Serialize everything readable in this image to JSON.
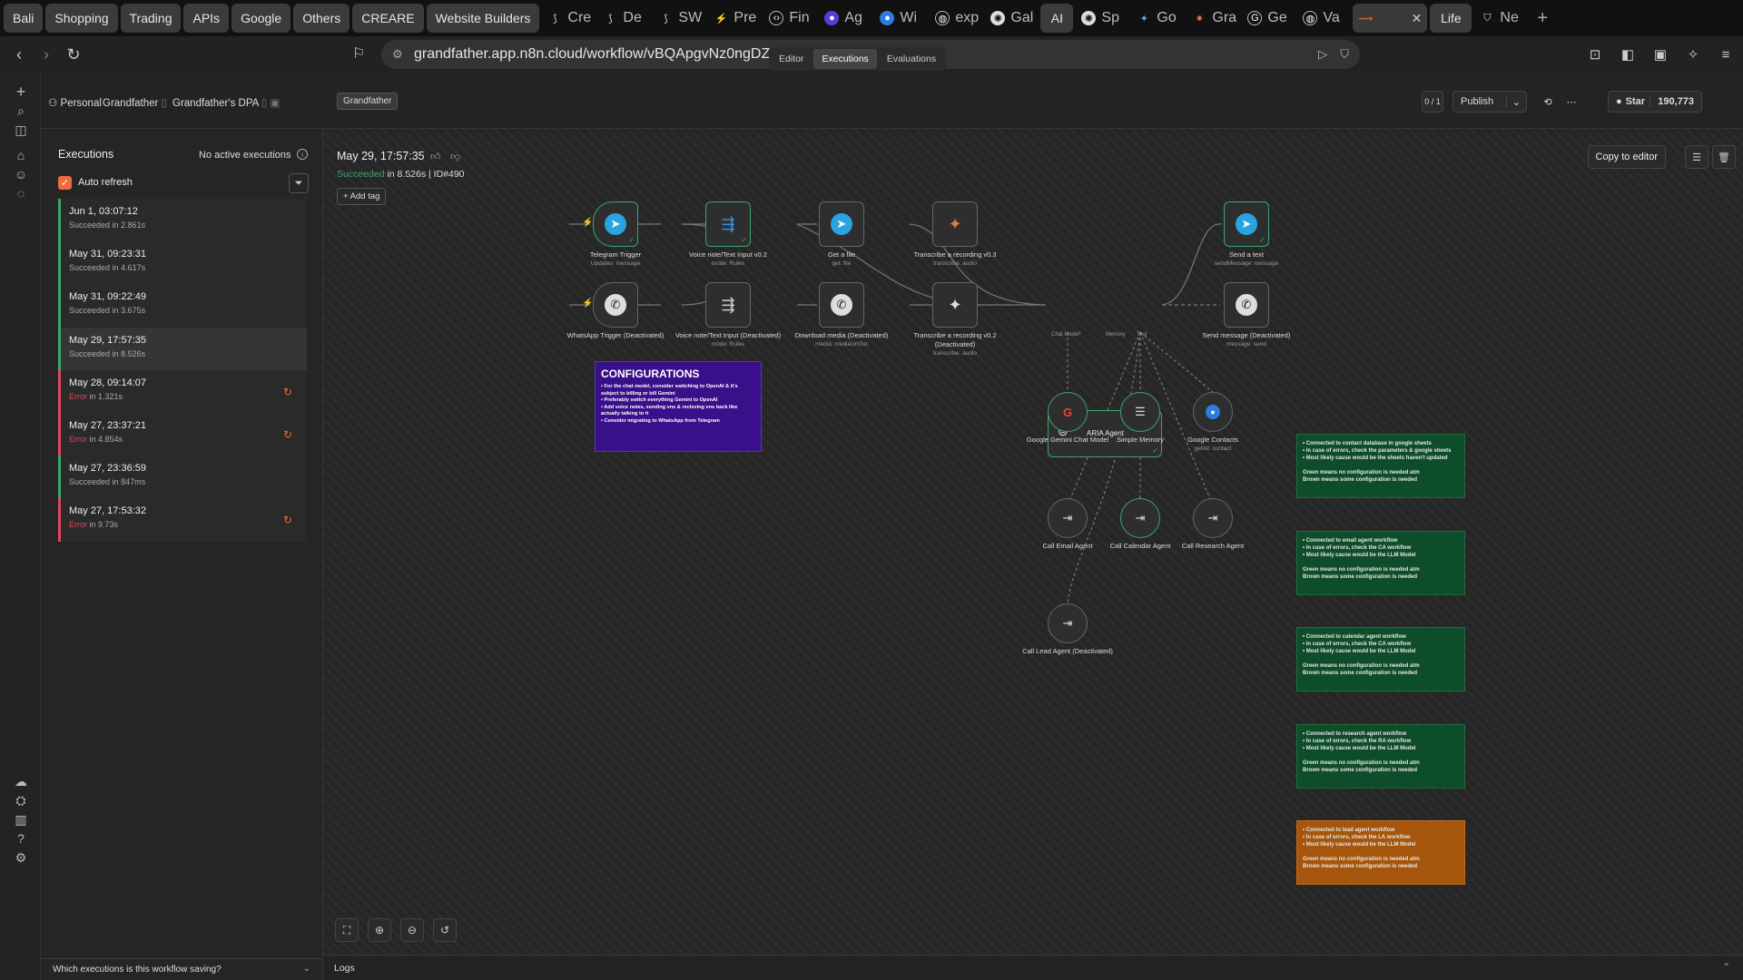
{
  "browser": {
    "bookmarks": [
      "Bali",
      "Shopping",
      "Trading",
      "APIs",
      "Google",
      "Others",
      "CREARE",
      "Website Builders"
    ],
    "tabs": [
      {
        "label": "Cre",
        "icon": "n8n-icon"
      },
      {
        "label": "De",
        "icon": "n8n-icon"
      },
      {
        "label": "SW",
        "icon": "n8n-icon"
      },
      {
        "label": "Pre",
        "icon": "bolt-icon"
      },
      {
        "label": "Fin",
        "icon": "code-icon"
      },
      {
        "label": "Ag",
        "icon": "app-icon"
      },
      {
        "label": "Wi",
        "icon": "app-icon"
      },
      {
        "label": "exp",
        "icon": "globe-icon"
      },
      {
        "label": "Gal",
        "icon": "chatgpt-icon"
      },
      {
        "label": "AI",
        "icon": ""
      },
      {
        "label": "Sp",
        "icon": "chatgpt-icon"
      },
      {
        "label": "Go",
        "icon": "gemini-icon"
      },
      {
        "label": "Gra",
        "icon": "claude-icon"
      },
      {
        "label": "Ge",
        "icon": "app-icon"
      },
      {
        "label": "Va",
        "icon": "globe-icon"
      },
      {
        "label": "",
        "icon": "n8n-icon",
        "active": true
      },
      {
        "label": "Life",
        "icon": ""
      },
      {
        "label": "Ne",
        "icon": "shield-icon"
      }
    ],
    "url": "grandfather.app.n8n.cloud/workflow/vBQApgvNz0ngDZNV/executions/490"
  },
  "header": {
    "crumbs": [
      "Personal",
      "Grandfather",
      "Grandfather's DPA"
    ],
    "tag": "Grandfather",
    "tabs": [
      "Editor",
      "Executions",
      "Evaluations"
    ],
    "active_tab": "Executions",
    "counter": "0 / 1",
    "publish_label": "Publish",
    "star_label": "Star",
    "star_count": "190,773"
  },
  "sidebar": {
    "title": "Executions",
    "no_active": "No active executions",
    "auto_refresh": "Auto refresh",
    "executions": [
      {
        "date": "Jun 1, 03:07:12",
        "status": "Succeeded",
        "time": "in 2.861s",
        "error": false
      },
      {
        "date": "May 31, 09:23:31",
        "status": "Succeeded",
        "time": "in 4.617s",
        "error": false
      },
      {
        "date": "May 31, 09:22:49",
        "status": "Succeeded",
        "time": "in 3.675s",
        "error": false
      },
      {
        "date": "May 29, 17:57:35",
        "status": "Succeeded",
        "time": "in 8.526s",
        "error": false,
        "selected": true
      },
      {
        "date": "May 28, 09:14:07",
        "status": "Error",
        "time": "in 1.321s",
        "error": true
      },
      {
        "date": "May 27, 23:37:21",
        "status": "Error",
        "time": "in 4.854s",
        "error": true
      },
      {
        "date": "May 27, 23:36:59",
        "status": "Succeeded",
        "time": "in 847ms",
        "error": false
      },
      {
        "date": "May 27, 17:53:32",
        "status": "Error",
        "time": "in 9.73s",
        "error": true
      }
    ],
    "bottom_question": "Which executions is this workflow saving?"
  },
  "run": {
    "title": "May 29, 17:57:35",
    "status": "Succeeded",
    "details": "in 8.526s | ID#490",
    "add_tag": "+ Add tag",
    "copy_to_editor": "Copy to editor"
  },
  "nodes": {
    "telegram_trigger": {
      "label": "Telegram Trigger",
      "sub": "Updates: message"
    },
    "voice_v2": {
      "label": "Voice note/Text Input v0.2",
      "sub": "mode: Rules"
    },
    "get_file": {
      "label": "Get a file",
      "sub": "get: file"
    },
    "transcribe_v3": {
      "label": "Transcribe a recording v0.3",
      "sub": "transcribe: audio"
    },
    "send_text": {
      "label": "Send a text",
      "sub": "sendMessage: message"
    },
    "whatsapp_trigger": {
      "label": "WhatsApp Trigger (Deactivated)",
      "sub": ""
    },
    "voice_input": {
      "label": "Voice note/Text Input (Deactivated)",
      "sub": "mode: Rules"
    },
    "download_media": {
      "label": "Download media (Deactivated)",
      "sub": "media: mediaUrlGet"
    },
    "transcribe_v2": {
      "label": "Transcribe a recording v0.2 (Deactivated)",
      "sub": "transcribe: audio"
    },
    "aria_agent": {
      "label": "ARIA Agent"
    },
    "send_message": {
      "label": "Send message (Deactivated)",
      "sub": "message: send"
    },
    "gemini_model": {
      "label": "Google Gemini Chat Model"
    },
    "simple_memory": {
      "label": "Simple Memory"
    },
    "google_contacts": {
      "label": "Google Contacts",
      "sub": "getAll: contact"
    },
    "call_email": {
      "label": "Call Email Agent"
    },
    "call_calendar": {
      "label": "Call Calendar Agent"
    },
    "call_research": {
      "label": "Call Research Agent"
    },
    "call_lead": {
      "label": "Call Lead Agent (Deactivated)"
    }
  },
  "configurations": {
    "title": "CONFIGURATIONS",
    "lines": [
      "• For the chat model, consider switching to OpenAI & it's subject to billing or bill Gemini",
      "• Preferably switch everything Gemini to OpenAI",
      "• Add voice notes, sending vns & recieving vns back like actually talking to it",
      "• Consider migrating to WhatsApp from Telegram"
    ]
  },
  "notes": [
    {
      "color": "#0e4d2a",
      "lines": [
        "• Connected to contact database in google sheets",
        "• In case of errors, check the parameters & google sheets",
        "• Most likely cause would be the sheets haven't updated",
        "",
        "Green means no configuration is needed atm",
        "Brown means some configuration is needed"
      ]
    },
    {
      "color": "#0e4d2a",
      "lines": [
        "• Connected to email agent workflow",
        "• In case of errors, check the CA workflow",
        "• Most likely cause would be the LLM Model",
        "",
        "Green means no configuration is needed atm",
        "Brown means some configuration is needed"
      ]
    },
    {
      "color": "#0e4d2a",
      "lines": [
        "• Connected to calendar agent workflow",
        "• In case of errors, check the CA workflow",
        "• Most likely cause would be the LLM Model",
        "",
        "Green means no configuration is needed atm",
        "Brown means some configuration is needed"
      ]
    },
    {
      "color": "#0e4d2a",
      "lines": [
        "• Connected to research agent workflow",
        "• In case of errors, check the RA workflow",
        "• Most likely cause would be the LLM Model",
        "",
        "Green means no configuration is needed atm",
        "Brown means some configuration is needed"
      ]
    },
    {
      "color": "#a5560c",
      "lines": [
        "• Connected to lead agent workflow",
        "• In case of errors, check the LA workflow",
        "• Most likely cause would be the LLM Model",
        "",
        "Green means no configuration is needed atm",
        "Brown means some configuration is needed"
      ]
    }
  ],
  "port_labels": {
    "chat_model": "Chat Model*",
    "memory": "Memory",
    "tool": "Tool",
    "model": "Model"
  },
  "logs_label": "Logs"
}
